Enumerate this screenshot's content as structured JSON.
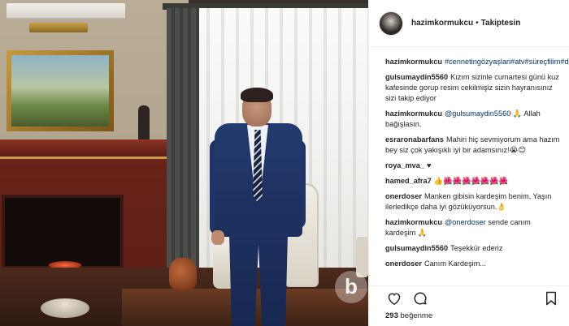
{
  "header": {
    "username": "hazimkormukcu",
    "separator": "•",
    "follow_status": "Takiptesin"
  },
  "comments": [
    {
      "user": "hazimkormukcu",
      "text": "#cennetingözyaşlari#atv#süreçfilim#dizi",
      "kind": "tags"
    },
    {
      "user": "gulsumaydin5560",
      "text": "Kızım sizinle cumartesi günü kuz kafesinde gorup resim cekilmişiz sizin hayranısınız sizi takip ediyor"
    },
    {
      "user": "hazimkormukcu",
      "mention": "@gulsumaydin5560",
      "text": "🙏 Allah bağışlasın."
    },
    {
      "user": "esraronabarfans",
      "text": "Mahiri hiç sevmiyorum ama hazım bey siz çok yakışıklı iyi bir adamsınız!😭😊"
    },
    {
      "user": "roya_mva_",
      "text": "♥"
    },
    {
      "user": "hamed_afra7",
      "text": "👍🌺🌺🌺🌺🌺🌺🌺"
    },
    {
      "user": "onerdoser",
      "text": "Manken gibisin kardeşim benim. Yaşın ilerledikçe daha iyi gözüküyorsun.👌"
    },
    {
      "user": "hazimkormukcu",
      "mention": "@onerdoser",
      "text": "sende canım kardeşim 🙏"
    },
    {
      "user": "gulsumaydin5560",
      "text": "Teşekkür ederiz"
    },
    {
      "user": "onerdoser",
      "text": "Canım Kardeşim..."
    }
  ],
  "actions": {
    "like_icon": "heart-icon",
    "comment_icon": "comment-icon",
    "save_icon": "bookmark-icon"
  },
  "likes": {
    "count": "293",
    "label": "beğenme"
  },
  "photo": {
    "watermark": "b"
  }
}
